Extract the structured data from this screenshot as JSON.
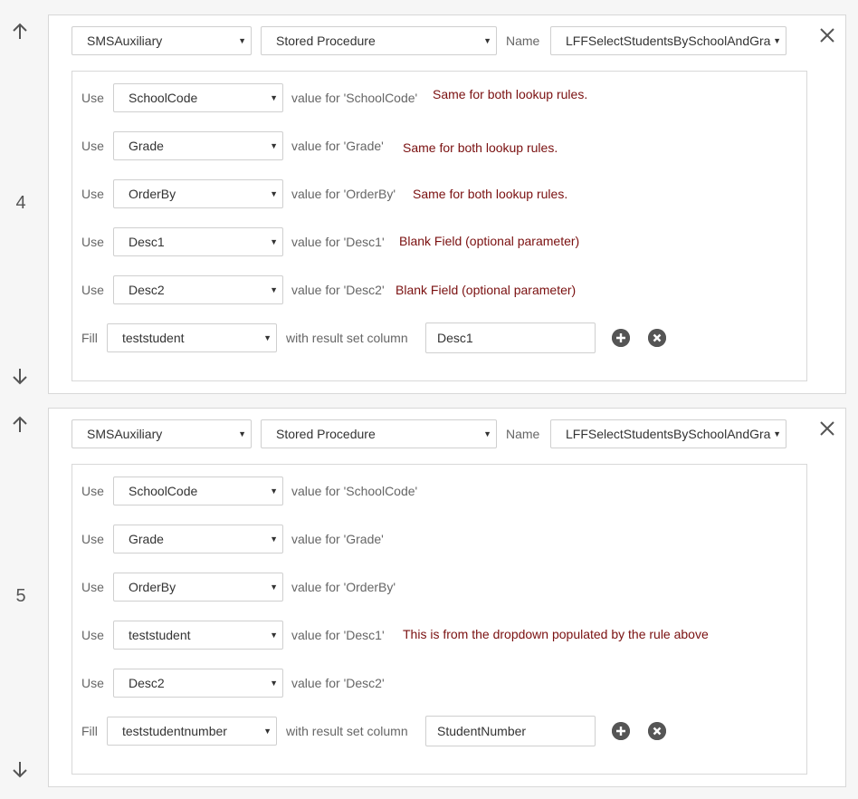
{
  "rules": [
    {
      "number": "4",
      "database": "SMSAuxiliary",
      "type": "Stored Procedure",
      "name_label": "Name",
      "name_value": "LFFSelectStudentsBySchoolAndGra",
      "params": [
        {
          "use": "Use",
          "field": "SchoolCode",
          "value_for": "value for 'SchoolCode'",
          "note": "Same for both lookup rules."
        },
        {
          "use": "Use",
          "field": "Grade",
          "value_for": "value for 'Grade'",
          "note": "Same for both lookup rules."
        },
        {
          "use": "Use",
          "field": "OrderBy",
          "value_for": "value for 'OrderBy'",
          "note": "Same for both lookup rules."
        },
        {
          "use": "Use",
          "field": "Desc1",
          "value_for": "value for 'Desc1'",
          "note": "Blank Field (optional parameter)"
        },
        {
          "use": "Use",
          "field": "Desc2",
          "value_for": "value for 'Desc2'",
          "note": "Blank Field (optional parameter)"
        }
      ],
      "fill": {
        "label": "Fill",
        "field": "teststudent",
        "with_label": "with result set column",
        "column": "Desc1"
      }
    },
    {
      "number": "5",
      "database": "SMSAuxiliary",
      "type": "Stored Procedure",
      "name_label": "Name",
      "name_value": "LFFSelectStudentsBySchoolAndGra",
      "params": [
        {
          "use": "Use",
          "field": "SchoolCode",
          "value_for": "value for 'SchoolCode'",
          "note": ""
        },
        {
          "use": "Use",
          "field": "Grade",
          "value_for": "value for 'Grade'",
          "note": ""
        },
        {
          "use": "Use",
          "field": "OrderBy",
          "value_for": "value for 'OrderBy'",
          "note": ""
        },
        {
          "use": "Use",
          "field": "teststudent",
          "value_for": "value for 'Desc1'",
          "note": "This is from the dropdown populated by the rule above"
        },
        {
          "use": "Use",
          "field": "Desc2",
          "value_for": "value for 'Desc2'",
          "note": ""
        }
      ],
      "fill": {
        "label": "Fill",
        "field": "teststudentnumber",
        "with_label": "with result set column",
        "column": "StudentNumber"
      }
    }
  ],
  "icons": {
    "move_up": "arrow-up-icon",
    "move_down": "arrow-down-icon",
    "remove_rule": "close-icon",
    "add": "plus-circle-icon",
    "remove": "x-circle-icon"
  },
  "colors": {
    "note_text": "#7a1010",
    "icon_fill": "#555555"
  }
}
